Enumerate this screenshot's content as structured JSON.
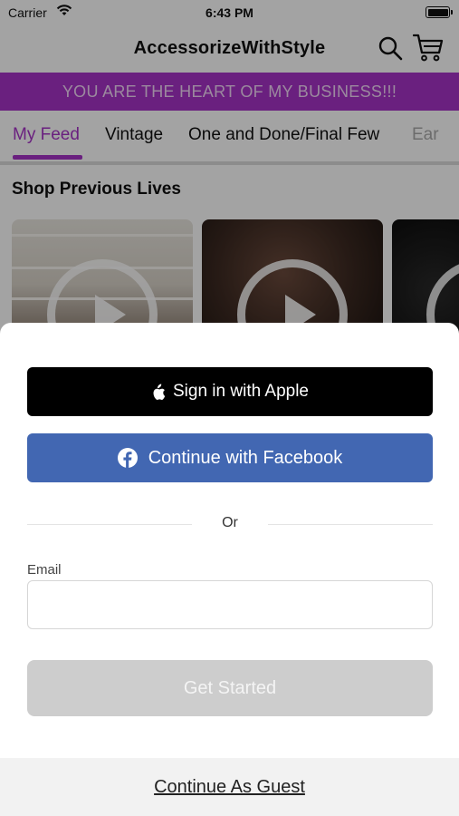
{
  "status_bar": {
    "carrier": "Carrier",
    "time": "6:43 PM"
  },
  "header": {
    "title": "AccessorizeWithStyle",
    "search_icon": "search-icon",
    "cart_icon": "cart-icon"
  },
  "promo_banner": {
    "text": "YOU ARE THE HEART OF MY BUSINESS!!!",
    "background": "#a633c7"
  },
  "tabs": [
    {
      "label": "My Feed",
      "active": true
    },
    {
      "label": "Vintage",
      "active": false
    },
    {
      "label": "One and Done/Final Few",
      "active": false
    },
    {
      "label": "Ear",
      "active": false
    }
  ],
  "section": {
    "title": "Shop Previous Lives"
  },
  "sign_in_sheet": {
    "apple_button": "Sign in with Apple",
    "facebook_button": "Continue with Facebook",
    "divider_text": "Or",
    "email_label": "Email",
    "email_value": "",
    "email_placeholder": "",
    "get_started_button": "Get Started",
    "guest_link": "Continue As Guest"
  },
  "colors": {
    "accent": "#a633c7",
    "facebook": "#4267b2",
    "apple": "#000000",
    "disabled_button": "#cdcdcd"
  }
}
